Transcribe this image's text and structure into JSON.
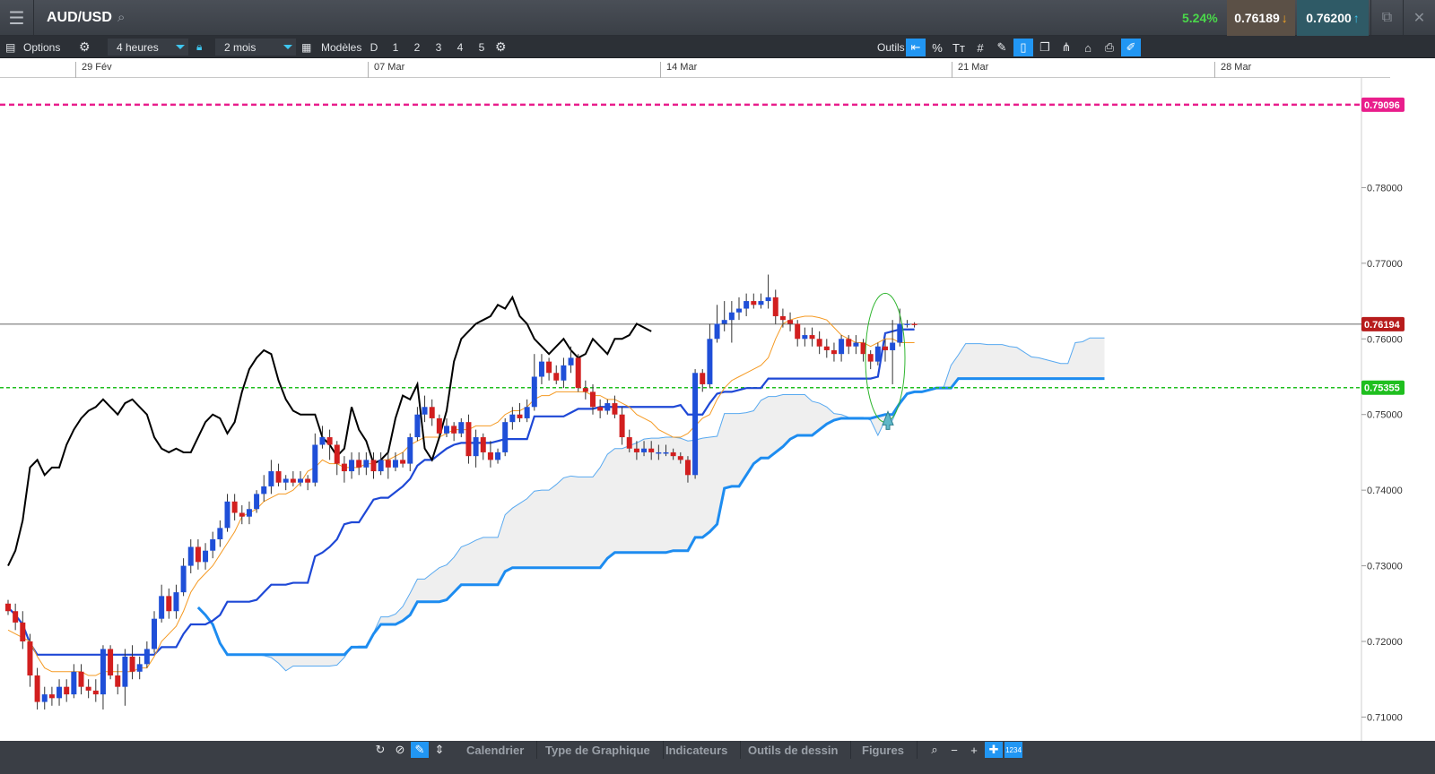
{
  "header": {
    "symbol": "AUD/USD",
    "change_pct": "5.24%",
    "sell_price": "0.76189",
    "buy_price": "0.76200"
  },
  "toolbar": {
    "options_label": "Options",
    "interval": "4 heures",
    "period": "2 mois",
    "templates_label": "Modèles",
    "template_slots": [
      "D",
      "1",
      "2",
      "3",
      "4",
      "5"
    ],
    "tools_label": "Outils",
    "tool_icons": [
      "crosshair-arrow-icon",
      "percent-icon",
      "text-size-icon",
      "grid-icon",
      "pencil-grid-icon",
      "candle-icon",
      "windows-icon",
      "tuning-fork-icon",
      "tag-icon",
      "print-icon",
      "settings-ruler-icon"
    ]
  },
  "dates": [
    "29 Fév",
    "07 Mar",
    "14 Mar",
    "21 Mar",
    "28 Mar"
  ],
  "chart_data": {
    "type": "candlestick",
    "instrument": "AUD/USD",
    "y_ticks": [
      "0.78000",
      "0.77000",
      "0.76000",
      "0.75000",
      "0.74000",
      "0.73000",
      "0.72000",
      "0.71000"
    ],
    "ylim": [
      0.7065,
      0.7945
    ],
    "price_labels": [
      {
        "value": "0.79096",
        "color": "#e91e8c"
      },
      {
        "value": "0.76194",
        "color": "#b71c1c"
      },
      {
        "value": "0.75355",
        "color": "#1fbf1f"
      }
    ],
    "candles": [
      [
        0.725,
        0.724,
        0.7255,
        0.7235
      ],
      [
        0.724,
        0.7225,
        0.725,
        0.7215
      ],
      [
        0.7225,
        0.72,
        0.724,
        0.719
      ],
      [
        0.72,
        0.7155,
        0.721,
        0.714
      ],
      [
        0.7155,
        0.712,
        0.7165,
        0.711
      ],
      [
        0.712,
        0.713,
        0.714,
        0.711
      ],
      [
        0.713,
        0.7125,
        0.714,
        0.7115
      ],
      [
        0.7125,
        0.714,
        0.715,
        0.7115
      ],
      [
        0.714,
        0.713,
        0.715,
        0.712
      ],
      [
        0.713,
        0.716,
        0.717,
        0.7125
      ],
      [
        0.716,
        0.714,
        0.717,
        0.713
      ],
      [
        0.714,
        0.7135,
        0.715,
        0.7125
      ],
      [
        0.7135,
        0.713,
        0.715,
        0.712
      ],
      [
        0.713,
        0.719,
        0.7195,
        0.711
      ],
      [
        0.719,
        0.7155,
        0.7195,
        0.715
      ],
      [
        0.7155,
        0.714,
        0.717,
        0.713
      ],
      [
        0.714,
        0.718,
        0.719,
        0.7115
      ],
      [
        0.718,
        0.716,
        0.7195,
        0.715
      ],
      [
        0.716,
        0.717,
        0.718,
        0.715
      ],
      [
        0.717,
        0.719,
        0.72,
        0.7165
      ],
      [
        0.719,
        0.723,
        0.724,
        0.7185
      ],
      [
        0.723,
        0.726,
        0.7275,
        0.7225
      ],
      [
        0.726,
        0.724,
        0.727,
        0.723
      ],
      [
        0.724,
        0.7265,
        0.7275,
        0.723
      ],
      [
        0.7265,
        0.73,
        0.731,
        0.726
      ],
      [
        0.73,
        0.7325,
        0.7335,
        0.729
      ],
      [
        0.7325,
        0.7305,
        0.7335,
        0.7295
      ],
      [
        0.7305,
        0.732,
        0.733,
        0.7295
      ],
      [
        0.732,
        0.7335,
        0.7345,
        0.731
      ],
      [
        0.7335,
        0.735,
        0.736,
        0.7325
      ],
      [
        0.735,
        0.7385,
        0.7395,
        0.7345
      ],
      [
        0.7385,
        0.737,
        0.7395,
        0.736
      ],
      [
        0.737,
        0.7365,
        0.738,
        0.7355
      ],
      [
        0.7365,
        0.7375,
        0.7385,
        0.7355
      ],
      [
        0.7375,
        0.7395,
        0.74,
        0.737
      ],
      [
        0.7395,
        0.7405,
        0.742,
        0.7385
      ],
      [
        0.7405,
        0.7425,
        0.744,
        0.7395
      ],
      [
        0.7425,
        0.741,
        0.7435,
        0.7405
      ],
      [
        0.741,
        0.7415,
        0.742,
        0.74
      ],
      [
        0.7415,
        0.741,
        0.7425,
        0.7405
      ],
      [
        0.741,
        0.7415,
        0.7425,
        0.7405
      ],
      [
        0.7415,
        0.741,
        0.742,
        0.74
      ],
      [
        0.741,
        0.746,
        0.7475,
        0.7405
      ],
      [
        0.746,
        0.747,
        0.7485,
        0.7455
      ],
      [
        0.747,
        0.746,
        0.748,
        0.744
      ],
      [
        0.746,
        0.7435,
        0.7465,
        0.742
      ],
      [
        0.7435,
        0.7425,
        0.7445,
        0.741
      ],
      [
        0.7425,
        0.744,
        0.745,
        0.7415
      ],
      [
        0.744,
        0.743,
        0.745,
        0.742
      ],
      [
        0.743,
        0.744,
        0.745,
        0.742
      ],
      [
        0.744,
        0.7425,
        0.745,
        0.7415
      ],
      [
        0.7425,
        0.744,
        0.745,
        0.742
      ],
      [
        0.744,
        0.743,
        0.745,
        0.7415
      ],
      [
        0.743,
        0.744,
        0.745,
        0.7425
      ],
      [
        0.744,
        0.7435,
        0.745,
        0.743
      ],
      [
        0.7435,
        0.747,
        0.7475,
        0.7425
      ],
      [
        0.747,
        0.75,
        0.751,
        0.7465
      ],
      [
        0.75,
        0.751,
        0.7525,
        0.749
      ],
      [
        0.751,
        0.7495,
        0.752,
        0.7485
      ],
      [
        0.7495,
        0.7475,
        0.75,
        0.747
      ],
      [
        0.7475,
        0.7485,
        0.7495,
        0.747
      ],
      [
        0.7485,
        0.7475,
        0.749,
        0.7465
      ],
      [
        0.7475,
        0.749,
        0.7495,
        0.747
      ],
      [
        0.749,
        0.7445,
        0.75,
        0.7435
      ],
      [
        0.7445,
        0.747,
        0.748,
        0.743
      ],
      [
        0.747,
        0.745,
        0.7475,
        0.744
      ],
      [
        0.745,
        0.744,
        0.7465,
        0.743
      ],
      [
        0.744,
        0.745,
        0.7455,
        0.7435
      ],
      [
        0.745,
        0.749,
        0.7495,
        0.7445
      ],
      [
        0.749,
        0.75,
        0.751,
        0.748
      ],
      [
        0.75,
        0.7495,
        0.7515,
        0.749
      ],
      [
        0.7495,
        0.751,
        0.752,
        0.749
      ],
      [
        0.751,
        0.755,
        0.758,
        0.7505
      ],
      [
        0.755,
        0.757,
        0.758,
        0.754
      ],
      [
        0.757,
        0.7555,
        0.7575,
        0.7545
      ],
      [
        0.7555,
        0.7545,
        0.7565,
        0.754
      ],
      [
        0.7545,
        0.7565,
        0.7575,
        0.7535
      ],
      [
        0.7565,
        0.7575,
        0.759,
        0.7555
      ],
      [
        0.7575,
        0.7535,
        0.758,
        0.753
      ],
      [
        0.7535,
        0.753,
        0.7545,
        0.752
      ],
      [
        0.753,
        0.751,
        0.754,
        0.75
      ],
      [
        0.751,
        0.7505,
        0.752,
        0.7495
      ],
      [
        0.7505,
        0.7515,
        0.752,
        0.75
      ],
      [
        0.7515,
        0.75,
        0.7525,
        0.7495
      ],
      [
        0.75,
        0.747,
        0.751,
        0.746
      ],
      [
        0.747,
        0.7455,
        0.748,
        0.745
      ],
      [
        0.7455,
        0.745,
        0.7465,
        0.744
      ],
      [
        0.745,
        0.7455,
        0.7465,
        0.7445
      ],
      [
        0.7455,
        0.745,
        0.7465,
        0.744
      ],
      [
        0.745,
        0.745,
        0.746,
        0.744
      ],
      [
        0.745,
        0.745,
        0.746,
        0.7445
      ],
      [
        0.745,
        0.7445,
        0.7455,
        0.744
      ],
      [
        0.7445,
        0.744,
        0.745,
        0.7435
      ],
      [
        0.744,
        0.742,
        0.7445,
        0.741
      ],
      [
        0.742,
        0.7555,
        0.756,
        0.7415
      ],
      [
        0.7555,
        0.754,
        0.756,
        0.753
      ],
      [
        0.754,
        0.76,
        0.762,
        0.7535
      ],
      [
        0.76,
        0.762,
        0.7645,
        0.7595
      ],
      [
        0.762,
        0.7625,
        0.765,
        0.761
      ],
      [
        0.7625,
        0.7635,
        0.765,
        0.7595
      ],
      [
        0.7635,
        0.764,
        0.7655,
        0.7625
      ],
      [
        0.764,
        0.765,
        0.766,
        0.763
      ],
      [
        0.765,
        0.7645,
        0.766,
        0.764
      ],
      [
        0.7645,
        0.765,
        0.766,
        0.764
      ],
      [
        0.765,
        0.7655,
        0.7685,
        0.764
      ],
      [
        0.7655,
        0.763,
        0.7665,
        0.762
      ],
      [
        0.763,
        0.7625,
        0.764,
        0.7615
      ],
      [
        0.7625,
        0.762,
        0.7635,
        0.761
      ],
      [
        0.762,
        0.76,
        0.7625,
        0.759
      ],
      [
        0.76,
        0.7605,
        0.7615,
        0.759
      ],
      [
        0.7605,
        0.76,
        0.7615,
        0.759
      ],
      [
        0.76,
        0.759,
        0.761,
        0.758
      ],
      [
        0.759,
        0.7585,
        0.76,
        0.7575
      ],
      [
        0.7585,
        0.758,
        0.7595,
        0.757
      ],
      [
        0.758,
        0.76,
        0.7605,
        0.757
      ],
      [
        0.76,
        0.759,
        0.7605,
        0.758
      ],
      [
        0.759,
        0.7595,
        0.7605,
        0.758
      ],
      [
        0.7595,
        0.758,
        0.76,
        0.757
      ],
      [
        0.758,
        0.757,
        0.7585,
        0.756
      ],
      [
        0.757,
        0.759,
        0.7595,
        0.7565
      ],
      [
        0.759,
        0.7585,
        0.76,
        0.757
      ],
      [
        0.7585,
        0.7595,
        0.7625,
        0.754
      ],
      [
        0.7595,
        0.762,
        0.764,
        0.759
      ],
      [
        0.762,
        0.762,
        0.7625,
        0.7615
      ],
      [
        0.762,
        0.7619,
        0.7622,
        0.7615
      ]
    ],
    "tenkan_sen": [
      0.7215,
      0.721,
      0.7205,
      0.72,
      0.718,
      0.7165,
      0.716,
      0.716,
      0.716,
      0.716,
      0.716,
      0.7155,
      0.7155,
      0.716,
      0.716,
      0.716,
      0.716,
      0.716,
      0.7165,
      0.7165,
      0.718,
      0.72,
      0.721,
      0.722,
      0.724,
      0.7265,
      0.728,
      0.729,
      0.73,
      0.7315,
      0.733,
      0.7345,
      0.7365,
      0.737,
      0.7375,
      0.7385,
      0.739,
      0.7395,
      0.7395,
      0.74,
      0.741,
      0.7425,
      0.743,
      0.744,
      0.7435,
      0.7435,
      0.743,
      0.743,
      0.743,
      0.7435,
      0.7435,
      0.744,
      0.744,
      0.7445,
      0.745,
      0.746,
      0.7465,
      0.747,
      0.747,
      0.747,
      0.7475,
      0.748,
      0.748,
      0.748,
      0.7485,
      0.7485,
      0.7485,
      0.749,
      0.75,
      0.7505,
      0.7505,
      0.751,
      0.752,
      0.7525,
      0.7525,
      0.753,
      0.753,
      0.753,
      0.753,
      0.753,
      0.7525,
      0.7525,
      0.752,
      0.752,
      0.7515,
      0.751,
      0.75,
      0.7495,
      0.749,
      0.748,
      0.7475,
      0.747,
      0.747,
      0.7475,
      0.7485,
      0.7495,
      0.75,
      0.752,
      0.7535,
      0.7545,
      0.755,
      0.7555,
      0.756,
      0.7565,
      0.7575,
      0.76,
      0.762,
      0.7625,
      0.7628,
      0.763,
      0.763,
      0.7628,
      0.7625,
      0.7615,
      0.7605,
      0.76,
      0.7595,
      0.7595,
      0.759,
      0.7595,
      0.76,
      0.76,
      0.7595,
      0.7595,
      0.7595
    ],
    "chikou_span": [
      0.73,
      0.732,
      0.736,
      0.743,
      0.744,
      0.742,
      0.743,
      0.743,
      0.746,
      0.748,
      0.7495,
      0.7505,
      0.751,
      0.752,
      0.751,
      0.75,
      0.7515,
      0.752,
      0.751,
      0.75,
      0.747,
      0.7455,
      0.745,
      0.7455,
      0.745,
      0.745,
      0.747,
      0.749,
      0.75,
      0.7495,
      0.7475,
      0.749,
      0.753,
      0.756,
      0.7575,
      0.7585,
      0.758,
      0.7545,
      0.752,
      0.7505,
      0.75,
      0.75,
      0.75,
      0.747,
      0.746,
      0.7445,
      0.7455,
      0.751,
      0.748,
      0.7465,
      0.7435,
      0.744,
      0.745,
      0.7495,
      0.7525,
      0.752,
      0.754,
      0.7455,
      0.744,
      0.747,
      0.7505,
      0.757,
      0.76,
      0.761,
      0.762,
      0.7625,
      0.763,
      0.7645,
      0.764,
      0.7655,
      0.763,
      0.762,
      0.76,
      0.759,
      0.758,
      0.759,
      0.76,
      0.7585,
      0.7575,
      0.758,
      0.76,
      0.759,
      0.758,
      0.76,
      0.76,
      0.7605,
      0.762,
      0.7615,
      0.761
    ]
  },
  "bottom": {
    "tabs": [
      "Calendrier",
      "Type de Graphique",
      "Indicateurs",
      "Outils de dessin",
      "Figures"
    ],
    "zoom_value": "1234"
  },
  "colors": {
    "up_candle": "#1f4fd8",
    "down_candle": "#d21f1f",
    "kijun": "#1e48d6",
    "tenkan": "#f59a23",
    "chikou": "#000000",
    "senkou_a": "#58a9f0",
    "senkou_b": "#1d8cf0",
    "resistance": "#e91e8c",
    "support": "#1fbf1f",
    "highlight_ellipse": "#2fb52f"
  }
}
